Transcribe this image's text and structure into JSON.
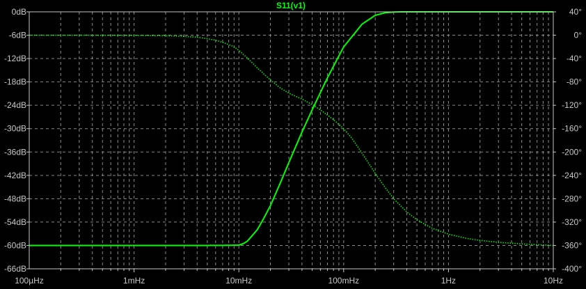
{
  "colors": {
    "background": "#000000",
    "grid": "#8a8a8a",
    "axis": "#c8c8c8",
    "tick_text": "#c8c8c8",
    "trace": "#00ff00"
  },
  "chart_data": {
    "type": "line",
    "title": "S11(v1)",
    "x_scale": "log",
    "xlim": [
      "100µHz",
      "10Hz"
    ],
    "x_decades": [
      0.0001,
      0.001,
      0.01,
      0.1,
      1,
      10
    ],
    "x_tick_labels": [
      "100µHz",
      "1mHz",
      "10mHz",
      "100mHz",
      "1Hz",
      "10Hz"
    ],
    "y_left": {
      "label": "",
      "unit": "dB",
      "ylim": [
        -66,
        0
      ],
      "ticks": [
        0,
        -6,
        -12,
        -18,
        -24,
        -30,
        -36,
        -42,
        -48,
        -54,
        -60,
        -66
      ],
      "tick_labels": [
        "0dB",
        "-6dB",
        "-12dB",
        "-18dB",
        "-24dB",
        "-30dB",
        "-36dB",
        "-42dB",
        "-48dB",
        "-54dB",
        "-60dB",
        "-66dB"
      ]
    },
    "y_right": {
      "label": "",
      "unit": "°",
      "ylim": [
        -400,
        40
      ],
      "ticks": [
        40,
        0,
        -40,
        -80,
        -120,
        -160,
        -200,
        -240,
        -280,
        -320,
        -360,
        -400
      ],
      "tick_labels": [
        "40°",
        "0°",
        "-40°",
        "-80°",
        "-120°",
        "-160°",
        "-200°",
        "-240°",
        "-280°",
        "-320°",
        "-360°",
        "-400°"
      ]
    },
    "grid": true,
    "series": [
      {
        "style": "dotted",
        "axis": "left",
        "x": [
          0.0001,
          0.0003,
          0.001,
          0.002,
          0.003,
          0.004,
          0.005,
          0.006,
          0.007,
          0.008,
          0.009,
          0.01,
          0.012,
          0.015,
          0.02,
          0.025,
          0.03,
          0.04,
          0.05,
          0.06,
          0.07,
          0.08,
          0.1,
          0.12,
          0.15,
          0.2,
          0.25,
          0.3,
          0.4,
          0.5,
          0.7,
          1,
          1.5,
          2,
          3,
          5,
          7,
          10
        ],
        "values": [
          -6.0,
          -6.0,
          -6.05,
          -6.15,
          -6.3,
          -6.5,
          -6.9,
          -7.3,
          -7.8,
          -8.4,
          -9.0,
          -9.9,
          -11.8,
          -14.4,
          -17.5,
          -19.6,
          -20.9,
          -22.4,
          -23.8,
          -25.2,
          -26.5,
          -27.7,
          -30.0,
          -32.5,
          -36.3,
          -41.5,
          -45.2,
          -48.0,
          -51.4,
          -53.4,
          -55.6,
          -57.1,
          -58.2,
          -58.7,
          -59.2,
          -59.6,
          -59.8,
          -60.0
        ]
      },
      {
        "style": "solid",
        "axis": "right",
        "x": [
          0.0001,
          0.001,
          0.005,
          0.008,
          0.01,
          0.011,
          0.012,
          0.013,
          0.015,
          0.017,
          0.02,
          0.025,
          0.03,
          0.04,
          0.05,
          0.07,
          0.1,
          0.15,
          0.2,
          0.25,
          0.3,
          0.35,
          0.4,
          1,
          10
        ],
        "values": [
          -360,
          -360,
          -360,
          -359.8,
          -359.5,
          -357,
          -353,
          -346,
          -333,
          -316,
          -292,
          -252,
          -218,
          -166,
          -128,
          -73,
          -20,
          19,
          34,
          38.5,
          39.6,
          40,
          40,
          40,
          40
        ]
      }
    ]
  }
}
